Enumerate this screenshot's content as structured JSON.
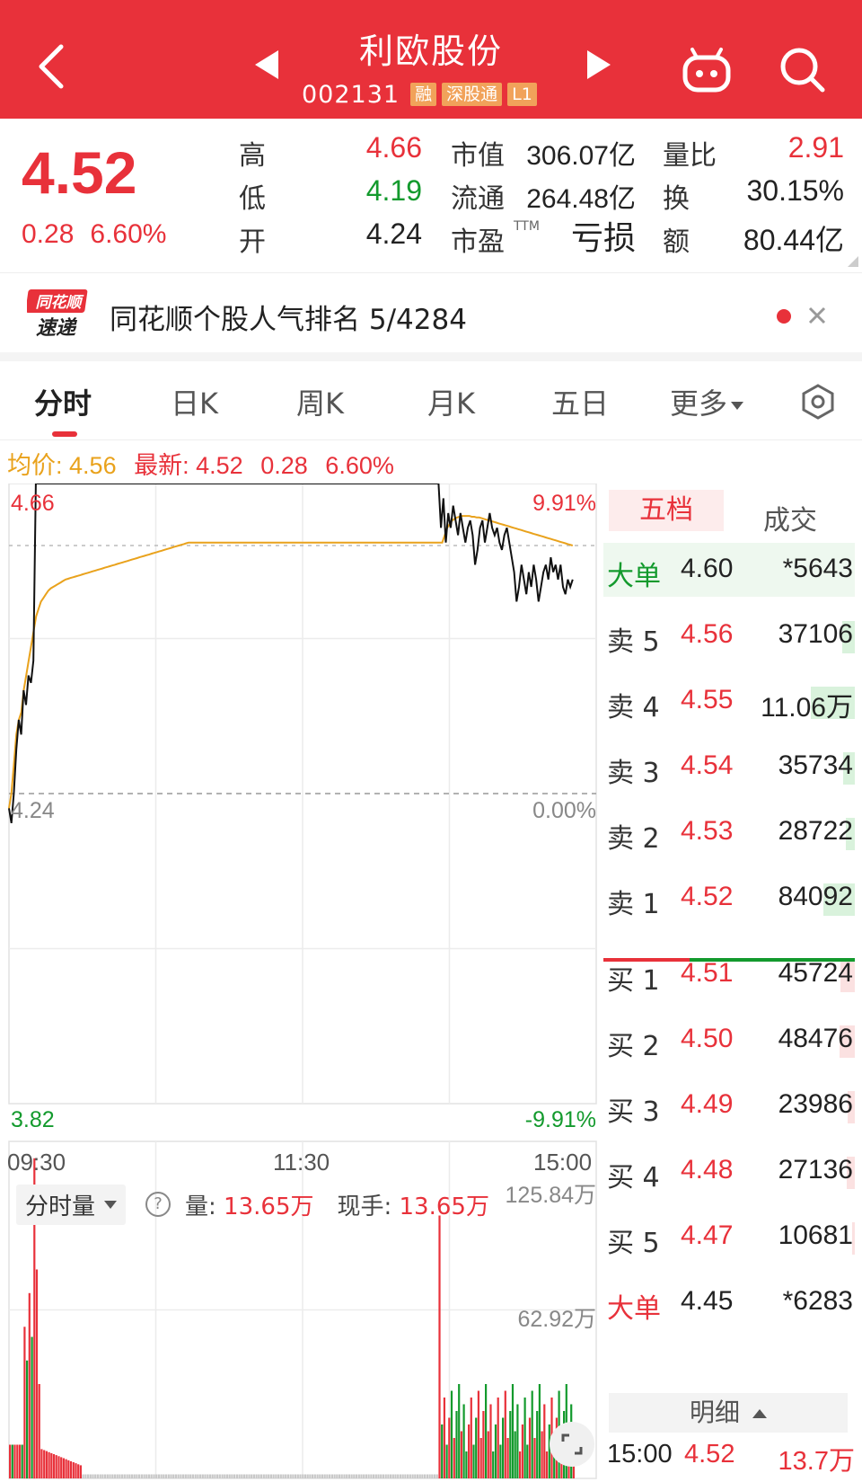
{
  "header": {
    "title": "利欧股份",
    "code": "002131",
    "tags": [
      "融",
      "深股通",
      "L1"
    ]
  },
  "quote": {
    "price": "4.52",
    "change": "0.28",
    "change_pct": "6.60%",
    "high_label": "高",
    "high": "4.66",
    "low_label": "低",
    "low": "4.19",
    "open_label": "开",
    "open": "4.24",
    "mcap_label": "市值",
    "mcap": "306.07亿",
    "float_label": "流通",
    "float": "264.48亿",
    "pe_label": "市盈",
    "pe_sup": "TTM",
    "pe": "亏损",
    "vol_ratio_label": "量比",
    "vol_ratio": "2.91",
    "turnover_label": "换",
    "turnover": "30.15%",
    "amount_label": "额",
    "amount": "80.44亿"
  },
  "rank": {
    "logo_line1": "同花顺",
    "logo_line2": "速递",
    "text": "同花顺个股人气排名 5/4284"
  },
  "tabs": [
    {
      "label": "分时",
      "active": true
    },
    {
      "label": "日K"
    },
    {
      "label": "周K"
    },
    {
      "label": "月K"
    },
    {
      "label": "五日"
    },
    {
      "label": "更多"
    }
  ],
  "avg": {
    "avg_label": "均价:",
    "avg_value": "4.56",
    "latest_label": "最新:",
    "latest_value": "4.52",
    "latest_chg": "0.28",
    "latest_pct": "6.60%"
  },
  "chart_labels": {
    "top_price": "4.66",
    "top_pct": "9.91%",
    "mid_price": "4.24",
    "mid_pct": "0.00%",
    "bottom_price": "3.82",
    "bottom_pct": "-9.91%",
    "t_start": "09:30",
    "t_mid": "11:30",
    "t_end": "15:00",
    "vol_top": "125.84万",
    "vol_mid": "62.92万"
  },
  "volume": {
    "select_label": "分时量",
    "help": "?",
    "vol_label": "量:",
    "vol_value": "13.65万",
    "hand_label": "现手:",
    "hand_value": "13.65万"
  },
  "book": {
    "tab_active": "五档",
    "tab_other": "成交",
    "big_sell": {
      "label": "大单",
      "price": "4.60",
      "qty": "*5643"
    },
    "sells": [
      {
        "label": "卖 5",
        "price": "4.56",
        "qty": "37106",
        "bar": 0.12
      },
      {
        "label": "卖 4",
        "price": "4.55",
        "qty": "11.06万",
        "bar": 0.42
      },
      {
        "label": "卖 3",
        "price": "4.54",
        "qty": "35734",
        "bar": 0.11
      },
      {
        "label": "卖 2",
        "price": "4.53",
        "qty": "28722",
        "bar": 0.09
      },
      {
        "label": "卖 1",
        "price": "4.52",
        "qty": "84092",
        "bar": 0.3
      }
    ],
    "buys": [
      {
        "label": "买 1",
        "price": "4.51",
        "qty": "45724",
        "bar": 0.14
      },
      {
        "label": "买 2",
        "price": "4.50",
        "qty": "48476",
        "bar": 0.15
      },
      {
        "label": "买 3",
        "price": "4.49",
        "qty": "23986",
        "bar": 0.07
      },
      {
        "label": "买 4",
        "price": "4.48",
        "qty": "27136",
        "bar": 0.08
      },
      {
        "label": "买 5",
        "price": "4.47",
        "qty": "10681",
        "bar": 0.03
      }
    ],
    "big_buy": {
      "label": "大单",
      "price": "4.45",
      "qty": "*6283"
    },
    "detail_label": "明细",
    "last_trade": {
      "time": "15:00",
      "price": "4.52",
      "qty": "13.7万"
    }
  },
  "colors": {
    "brand": "#e8313a",
    "up": "#e8313a",
    "down": "#139a2d",
    "avg_line": "#e9a21c"
  },
  "chart_data": {
    "type": "line",
    "x_range": [
      "09:30",
      "15:00"
    ],
    "ylim": [
      3.82,
      4.66
    ],
    "prev_close": 4.24,
    "series": [
      {
        "values": [
          4.22,
          4.2,
          4.24,
          4.3,
          4.34,
          4.32,
          4.38,
          4.36,
          4.4,
          4.39,
          4.42,
          4.66,
          4.66,
          4.66,
          4.66,
          4.66,
          4.66,
          4.66,
          4.66,
          4.66,
          4.66,
          4.66,
          4.66,
          4.66,
          4.66,
          4.66,
          4.66,
          4.66,
          4.66,
          4.66,
          4.66,
          4.66,
          4.66,
          4.66,
          4.66,
          4.66,
          4.66,
          4.66,
          4.66,
          4.66,
          4.66,
          4.66,
          4.66,
          4.66,
          4.66,
          4.66,
          4.66,
          4.66,
          4.66,
          4.66,
          4.66,
          4.66,
          4.66,
          4.66,
          4.66,
          4.66,
          4.66,
          4.66,
          4.66,
          4.66,
          4.66,
          4.66,
          4.66,
          4.66,
          4.66,
          4.66,
          4.66,
          4.66,
          4.66,
          4.66,
          4.66,
          4.66,
          4.66,
          4.66,
          4.66,
          4.66,
          4.66,
          4.66,
          4.66,
          4.66,
          4.66,
          4.66,
          4.66,
          4.66,
          4.66,
          4.66,
          4.66,
          4.66,
          4.66,
          4.66,
          4.66,
          4.66,
          4.66,
          4.66,
          4.66,
          4.66,
          4.66,
          4.66,
          4.66,
          4.66,
          4.66,
          4.66,
          4.66,
          4.66,
          4.66,
          4.66,
          4.66,
          4.66,
          4.66,
          4.66,
          4.66,
          4.66,
          4.66,
          4.66,
          4.66,
          4.66,
          4.66,
          4.66,
          4.66,
          4.66,
          4.66,
          4.66,
          4.66,
          4.66,
          4.66,
          4.66,
          4.66,
          4.66,
          4.66,
          4.66,
          4.66,
          4.66,
          4.66,
          4.66,
          4.66,
          4.66,
          4.66,
          4.66,
          4.66,
          4.66,
          4.66,
          4.66,
          4.66,
          4.66,
          4.66,
          4.66,
          4.66,
          4.66,
          4.66,
          4.66,
          4.66,
          4.66,
          4.66,
          4.66,
          4.66,
          4.66,
          4.66,
          4.66,
          4.66,
          4.66,
          4.66,
          4.66,
          4.66,
          4.66,
          4.66,
          4.66,
          4.66,
          4.66,
          4.66,
          4.66,
          4.66,
          4.66,
          4.66,
          4.66,
          4.66,
          4.66,
          4.66,
          4.6,
          4.64,
          4.58,
          4.62,
          4.6,
          4.63,
          4.61,
          4.59,
          4.62,
          4.6,
          4.58,
          4.6,
          4.61,
          4.59,
          4.55,
          4.57,
          4.6,
          4.61,
          4.58,
          4.6,
          4.62,
          4.6,
          4.59,
          4.6,
          4.58,
          4.57,
          4.59,
          4.6,
          4.58,
          4.56,
          4.54,
          4.5,
          4.52,
          4.55,
          4.53,
          4.51,
          4.54,
          4.52,
          4.55,
          4.53,
          4.5,
          4.52,
          4.54,
          4.55,
          4.53,
          4.56,
          4.54,
          4.55,
          4.53,
          4.55,
          4.52,
          4.51,
          4.53,
          4.52,
          4.53
        ]
      },
      {
        "values": [
          4.22,
          4.24,
          4.28,
          4.32,
          4.34,
          4.35,
          4.38,
          4.4,
          4.42,
          4.44,
          4.46,
          4.48,
          4.49,
          4.5,
          4.505,
          4.51,
          4.515,
          4.518,
          4.52,
          4.522,
          4.524,
          4.526,
          4.528,
          4.53,
          4.531,
          4.532,
          4.533,
          4.534,
          4.535,
          4.536,
          4.537,
          4.538,
          4.539,
          4.54,
          4.541,
          4.542,
          4.543,
          4.544,
          4.545,
          4.546,
          4.547,
          4.548,
          4.549,
          4.55,
          4.551,
          4.552,
          4.553,
          4.554,
          4.555,
          4.556,
          4.557,
          4.558,
          4.559,
          4.56,
          4.561,
          4.562,
          4.563,
          4.564,
          4.565,
          4.566,
          4.567,
          4.568,
          4.569,
          4.57,
          4.571,
          4.572,
          4.573,
          4.574,
          4.575,
          4.576,
          4.577,
          4.578,
          4.579,
          4.58,
          4.58,
          4.58,
          4.58,
          4.58,
          4.58,
          4.58,
          4.58,
          4.58,
          4.58,
          4.58,
          4.58,
          4.58,
          4.58,
          4.58,
          4.58,
          4.58,
          4.58,
          4.58,
          4.58,
          4.58,
          4.58,
          4.58,
          4.58,
          4.58,
          4.58,
          4.58,
          4.58,
          4.58,
          4.58,
          4.58,
          4.58,
          4.58,
          4.58,
          4.58,
          4.58,
          4.58,
          4.58,
          4.58,
          4.58,
          4.58,
          4.58,
          4.58,
          4.58,
          4.58,
          4.58,
          4.58,
          4.58,
          4.58,
          4.58,
          4.58,
          4.58,
          4.58,
          4.58,
          4.58,
          4.58,
          4.58,
          4.58,
          4.58,
          4.58,
          4.58,
          4.58,
          4.58,
          4.58,
          4.58,
          4.58,
          4.58,
          4.58,
          4.58,
          4.58,
          4.58,
          4.58,
          4.58,
          4.58,
          4.58,
          4.58,
          4.58,
          4.58,
          4.58,
          4.58,
          4.58,
          4.58,
          4.58,
          4.58,
          4.58,
          4.58,
          4.58,
          4.58,
          4.58,
          4.58,
          4.58,
          4.58,
          4.58,
          4.58,
          4.58,
          4.58,
          4.58,
          4.58,
          4.58,
          4.58,
          4.58,
          4.58,
          4.58,
          4.58,
          4.59,
          4.6,
          4.605,
          4.61,
          4.612,
          4.614,
          4.615,
          4.616,
          4.616,
          4.616,
          4.616,
          4.615,
          4.615,
          4.614,
          4.614,
          4.613,
          4.612,
          4.611,
          4.61,
          4.609,
          4.608,
          4.607,
          4.606,
          4.605,
          4.604,
          4.603,
          4.602,
          4.601,
          4.6,
          4.599,
          4.598,
          4.597,
          4.596,
          4.595,
          4.594,
          4.593,
          4.592,
          4.591,
          4.59,
          4.589,
          4.588,
          4.587,
          4.586,
          4.585,
          4.584,
          4.583,
          4.582,
          4.581,
          4.58,
          4.579,
          4.578,
          4.577,
          4.576
        ]
      }
    ]
  }
}
